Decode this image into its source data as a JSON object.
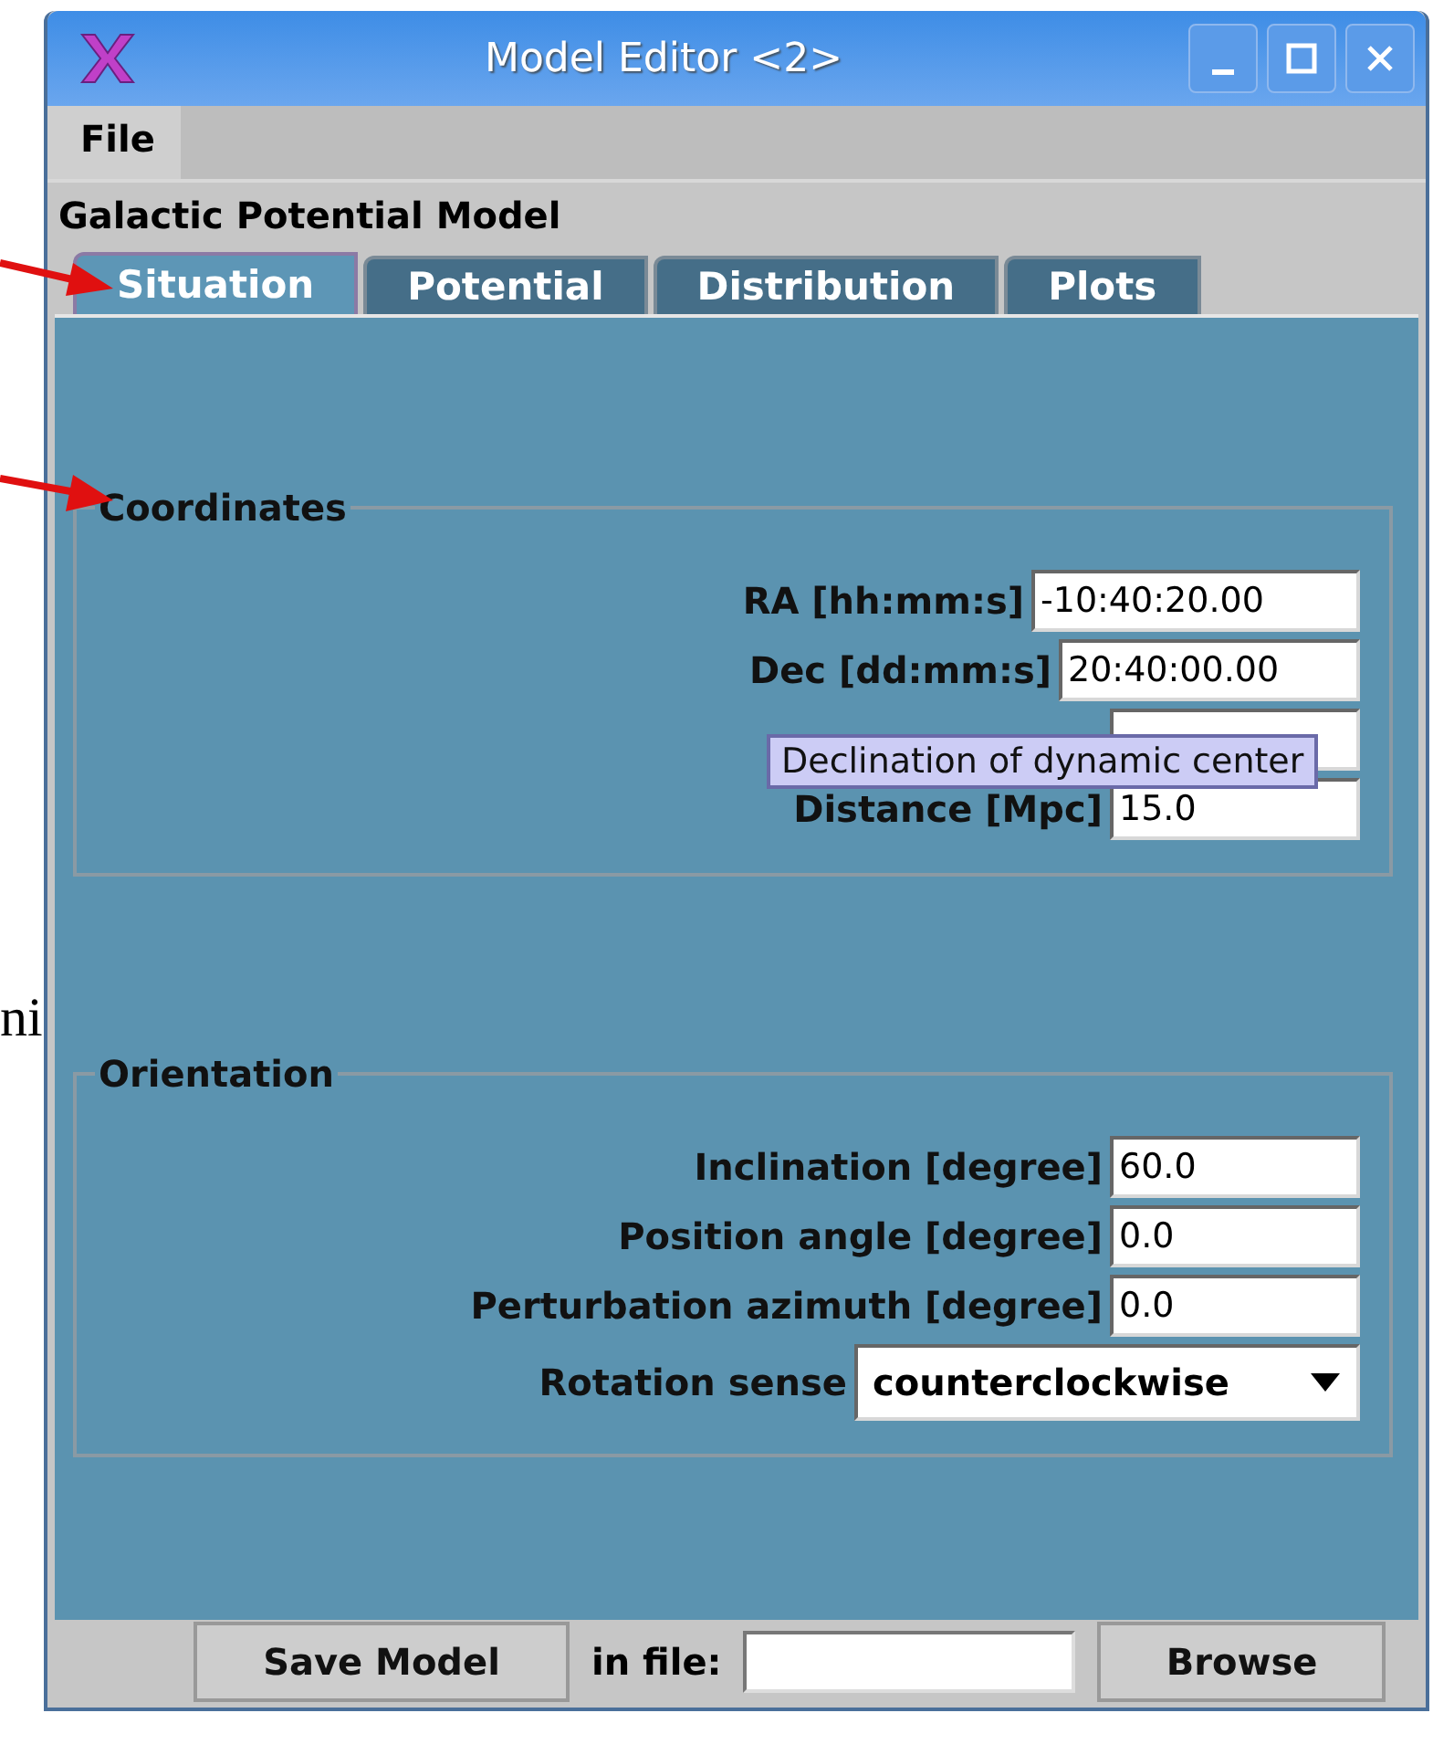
{
  "window": {
    "title": "Model Editor <2>"
  },
  "menu": [
    "File"
  ],
  "model_title": "Galactic Potential Model",
  "tabs": [
    {
      "label": "Situation",
      "selected": true
    },
    {
      "label": "Potential",
      "selected": false
    },
    {
      "label": "Distribution",
      "selected": false
    },
    {
      "label": "Plots",
      "selected": false
    }
  ],
  "sections": [
    {
      "title": "Coordinates",
      "fields": [
        {
          "kind": "text",
          "label": "RA [hh:mm:s]",
          "value": "-10:40:20.00"
        },
        {
          "kind": "text",
          "label": "Dec [dd:mm:s]",
          "value": "20:40:00.00"
        },
        {
          "kind": "covered"
        },
        {
          "kind": "text",
          "label": "Distance [Mpc]",
          "value": "15.0"
        }
      ]
    },
    {
      "title": "Orientation",
      "fields": [
        {
          "kind": "text",
          "label": "Inclination [degree]",
          "value": "60.0"
        },
        {
          "kind": "text",
          "label": "Position angle [degree]",
          "value": "0.0"
        },
        {
          "kind": "text",
          "label": "Perturbation azimuth [degree]",
          "value": "0.0"
        },
        {
          "kind": "dropdown",
          "label": "Rotation sense",
          "value": "counterclockwise"
        }
      ]
    }
  ],
  "tooltip": "Declination of dynamic center",
  "footer": {
    "save_button": "Save Model",
    "file_label": "in file:",
    "browse_button": "Browse"
  },
  "page_text": "ni"
}
